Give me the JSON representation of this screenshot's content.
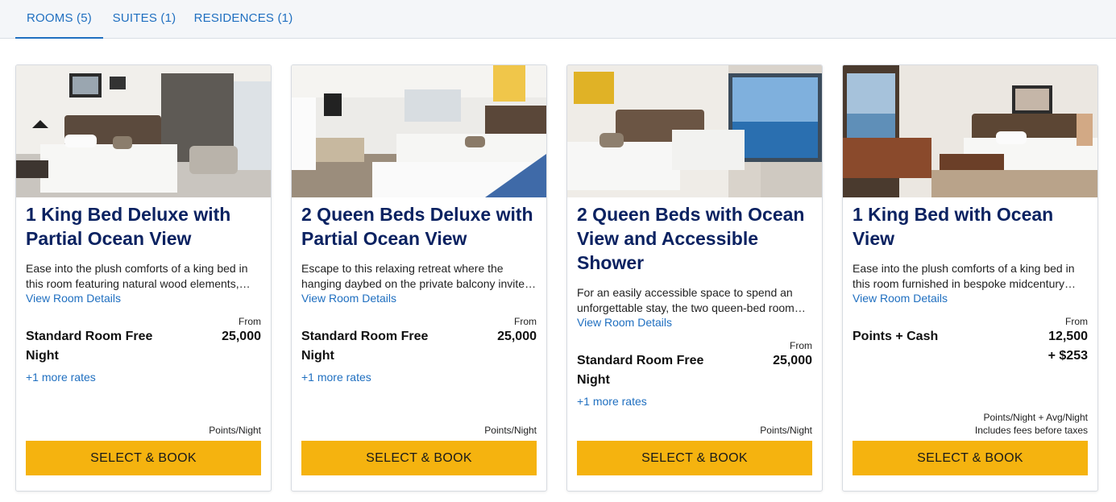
{
  "tabs": [
    {
      "label": "ROOMS (5)",
      "active": true
    },
    {
      "label": "SUITES (1)",
      "active": false
    },
    {
      "label": "RESIDENCES (1)",
      "active": false
    }
  ],
  "colors": {
    "accent": "#1f6fc0",
    "title": "#0b2261",
    "button": "#f5b30f"
  },
  "rooms": [
    {
      "title": "1 King Bed Deluxe with Partial Ocean View",
      "description": "Ease into the plush comforts of a king bed in this room featuring natural wood elements, crisp white linens and a freestanding soaking tub.",
      "details_link": "View Room Details",
      "rate_name": "Standard Room Free Night",
      "from_label": "From",
      "price": "25,000",
      "more_rates": "+1 more rates",
      "unit": "Points/Night",
      "button": "SELECT & BOOK"
    },
    {
      "title": "2 Queen Beds Deluxe with Partial Ocean View",
      "description": "Escape to this relaxing retreat where the hanging daybed on the private balcony invites long afternoons of rest by the sea.",
      "details_link": "View Room Details",
      "rate_name": "Standard Room Free Night",
      "from_label": "From",
      "price": "25,000",
      "more_rates": "+1 more rates",
      "unit": "Points/Night",
      "button": "SELECT & BOOK"
    },
    {
      "title": "2 Queen Beds with Ocean View and Accessible Shower",
      "description": "For an easily accessible space to spend an unforgettable stay, the two queen-bed room offers an accessible shower and sweeping ocean views.",
      "details_link": "View Room Details",
      "rate_name": "Standard Room Free Night",
      "from_label": "From",
      "price": "25,000",
      "more_rates": "+1 more rates",
      "unit": "Points/Night",
      "button": "SELECT & BOOK"
    },
    {
      "title": "1 King Bed with Ocean View",
      "description": "Ease into the plush comforts of a king bed in this room furnished in bespoke midcentury pieces and framed by ocean views.",
      "details_link": "View Room Details",
      "rate_name": "Points + Cash",
      "from_label": "From",
      "price": "12,500",
      "price_extra": "+ $253",
      "unit": "Points/Night + Avg/Night",
      "unit_extra": "Includes fees before taxes",
      "button": "SELECT & BOOK"
    }
  ]
}
